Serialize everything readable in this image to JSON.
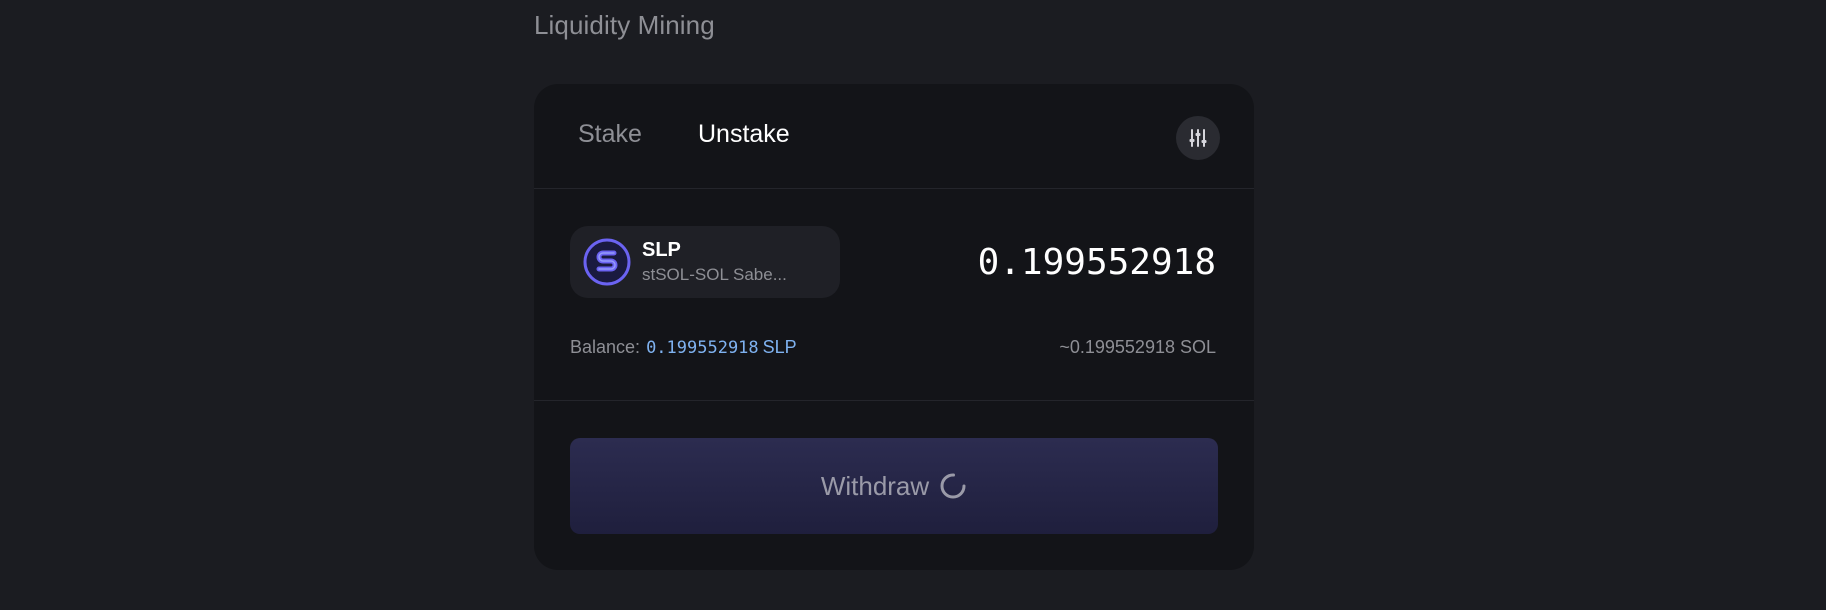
{
  "section": {
    "title": "Liquidity Mining"
  },
  "tabs": {
    "stake_label": "Stake",
    "unstake_label": "Unstake"
  },
  "token": {
    "symbol": "SLP",
    "name": "stSOL-SOL Sabe...",
    "icon": "saber-logo"
  },
  "input": {
    "amount": "0.199552918"
  },
  "balance": {
    "label": "Balance:",
    "value": "0.199552918",
    "unit": "SLP",
    "equivalent": "~0.199552918 SOL"
  },
  "actions": {
    "withdraw_label": "Withdraw"
  },
  "colors": {
    "background": "#1b1c21",
    "card": "#131418",
    "accent_link": "#7fb2f0",
    "button": "#2c2c50"
  }
}
